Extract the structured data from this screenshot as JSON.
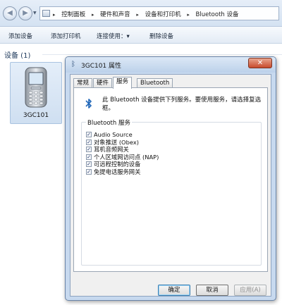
{
  "address_bar": {
    "crumbs": [
      "控制面板",
      "硬件和声音",
      "设备和打印机",
      "Bluetooth 设备"
    ],
    "separator": "▸",
    "back_icon": "back-arrow-icon",
    "forward_icon": "forward-arrow-icon"
  },
  "toolbar": {
    "add_device": "添加设备",
    "add_printer": "添加打印机",
    "connect_using": "连接使用：▾",
    "remove_device": "删除设备"
  },
  "devices": {
    "group_label": "设备 (1)",
    "items": [
      {
        "name": "3GC101",
        "icon": "mobile-phone-icon"
      }
    ]
  },
  "dialog": {
    "title": "3GC101 属性",
    "close_glyph": "✕",
    "tabs": [
      {
        "label": "常规",
        "active": false
      },
      {
        "label": "硬件",
        "active": false
      },
      {
        "label": "服务",
        "active": true
      },
      {
        "label": "Bluetooth",
        "active": false
      }
    ],
    "description": "此 Bluetooth 设备提供下列服务。要使用服务，请选择复选框。",
    "services_group_label": "Bluetooth 服务",
    "services": [
      {
        "label": "Audio Source",
        "checked": true
      },
      {
        "label": "对象推送 (Obex)",
        "checked": true
      },
      {
        "label": "耳机音频网关",
        "checked": true
      },
      {
        "label": "个人区域网访问点 (NAP)",
        "checked": true
      },
      {
        "label": "可远程控制的设备",
        "checked": true
      },
      {
        "label": "免提电话服务网关",
        "checked": true
      }
    ],
    "buttons": {
      "ok": "确定",
      "cancel": "取消",
      "apply": "应用(A)"
    }
  },
  "colors": {
    "bluetooth_blue": "#1f66b8",
    "close_button_red": "#c74a2c",
    "selected_tile": "#cfdff1"
  }
}
